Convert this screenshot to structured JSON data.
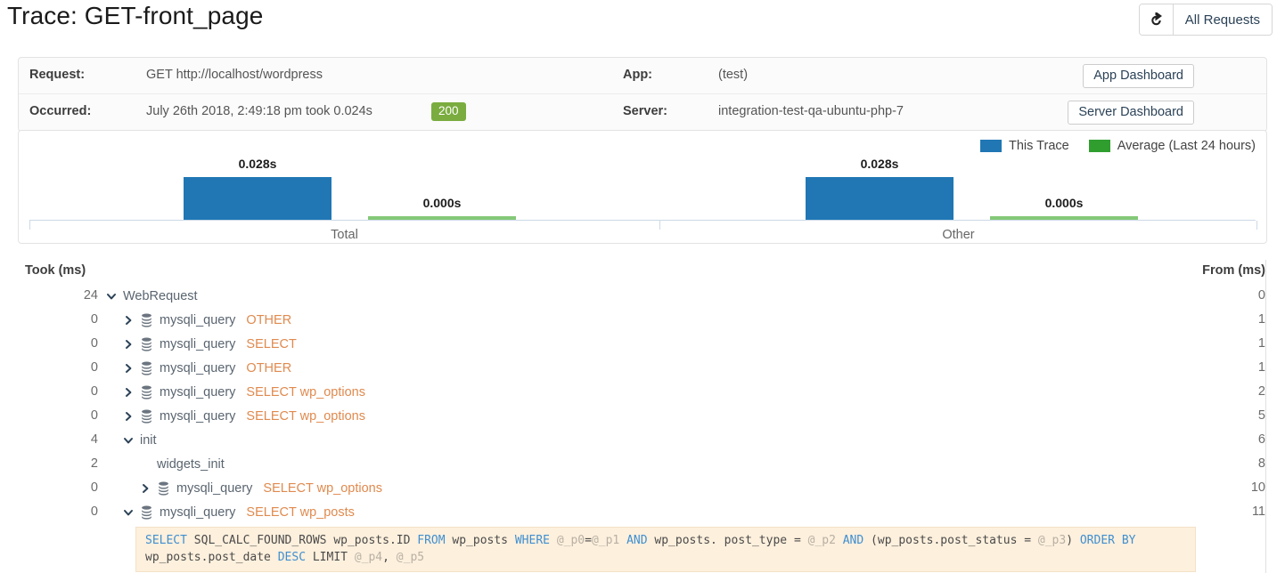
{
  "header": {
    "title": "Trace: GET-front_page",
    "refresh_icon": "share-refresh-icon",
    "all_requests_label": "All Requests"
  },
  "info": {
    "request_label": "Request:",
    "request_value": "GET http://localhost/wordpress",
    "occurred_label": "Occurred:",
    "occurred_value": "July 26th 2018, 2:49:18 pm took 0.024s",
    "status_code": "200",
    "status_color": "#7aac3f",
    "app_label": "App:",
    "app_value": "(test)",
    "server_label": "Server:",
    "server_value": "integration-test-qa-ubuntu-php-7",
    "app_dashboard_label": "App Dashboard",
    "server_dashboard_label": "Server Dashboard"
  },
  "chart_data": {
    "type": "bar",
    "title": "",
    "categories": [
      "Total",
      "Other"
    ],
    "series": [
      {
        "name": "This Trace",
        "color": "#2077b4",
        "values": [
          0.028,
          0.028
        ],
        "labels": [
          "0.028s",
          "0.028s"
        ]
      },
      {
        "name": "Average (Last 24 hours)",
        "color": "#2f9e2f",
        "bar_color": "#84c878",
        "values": [
          0.0,
          0.0
        ],
        "labels": [
          "0.000s",
          "0.000s"
        ]
      }
    ],
    "xlabel": "",
    "ylabel": "",
    "ylim": [
      0,
      0.035
    ],
    "grid": false,
    "legend_position": "top-right"
  },
  "legend": {
    "items": [
      {
        "label": "This Trace",
        "color": "#2077b4"
      },
      {
        "label": "Average (Last 24 hours)",
        "color": "#2f9e2f"
      }
    ]
  },
  "table": {
    "took_header": "Took (ms)",
    "from_header": "From (ms)",
    "rows": [
      {
        "took": "24",
        "level": 0,
        "toggle": "expanded",
        "icon": "none",
        "name": "WebRequest",
        "op": "",
        "from": "0"
      },
      {
        "took": "0",
        "level": 1,
        "toggle": "collapsed",
        "icon": "database",
        "name": "mysqli_query",
        "op": "OTHER",
        "from": "1"
      },
      {
        "took": "0",
        "level": 1,
        "toggle": "collapsed",
        "icon": "database",
        "name": "mysqli_query",
        "op": "SELECT",
        "from": "1"
      },
      {
        "took": "0",
        "level": 1,
        "toggle": "collapsed",
        "icon": "database",
        "name": "mysqli_query",
        "op": "OTHER",
        "from": "1"
      },
      {
        "took": "0",
        "level": 1,
        "toggle": "collapsed",
        "icon": "database",
        "name": "mysqli_query",
        "op": "SELECT wp_options",
        "from": "2"
      },
      {
        "took": "0",
        "level": 1,
        "toggle": "collapsed",
        "icon": "database",
        "name": "mysqli_query",
        "op": "SELECT wp_options",
        "from": "5"
      },
      {
        "took": "4",
        "level": 1,
        "toggle": "expanded",
        "icon": "none",
        "name": "init",
        "op": "",
        "from": "6"
      },
      {
        "took": "2",
        "level": 2,
        "toggle": "none",
        "icon": "none",
        "name": "widgets_init",
        "op": "",
        "from": "8"
      },
      {
        "took": "0",
        "level": 2,
        "toggle": "collapsed",
        "icon": "database",
        "name": "mysqli_query",
        "op": "SELECT wp_options",
        "from": "10"
      },
      {
        "took": "0",
        "level": 1,
        "toggle": "expanded",
        "icon": "database",
        "name": "mysqli_query",
        "op": "SELECT wp_posts",
        "from": "11"
      }
    ]
  },
  "sql": {
    "tokens": [
      {
        "t": "SELECT",
        "k": "kw"
      },
      {
        "t": " SQL_CALC_FOUND_ROWS wp_posts.ID ",
        "k": ""
      },
      {
        "t": "FROM",
        "k": "kw"
      },
      {
        "t": " wp_posts ",
        "k": ""
      },
      {
        "t": "WHERE",
        "k": "kw"
      },
      {
        "t": " ",
        "k": ""
      },
      {
        "t": "@_p0",
        "k": "param"
      },
      {
        "t": "=",
        "k": ""
      },
      {
        "t": "@_p1",
        "k": "param"
      },
      {
        "t": " ",
        "k": ""
      },
      {
        "t": "AND",
        "k": "kw"
      },
      {
        "t": " wp_posts. post_type = ",
        "k": ""
      },
      {
        "t": "@_p2",
        "k": "param"
      },
      {
        "t": " ",
        "k": ""
      },
      {
        "t": "AND",
        "k": "kw"
      },
      {
        "t": " (wp_posts.post_status = ",
        "k": ""
      },
      {
        "t": "@_p3",
        "k": "param"
      },
      {
        "t": ") ",
        "k": ""
      },
      {
        "t": "ORDER BY",
        "k": "kw"
      },
      {
        "t": " wp_posts.post_date ",
        "k": ""
      },
      {
        "t": "DESC",
        "k": "kw"
      },
      {
        "t": " LIMIT ",
        "k": ""
      },
      {
        "t": "@_p4",
        "k": "param"
      },
      {
        "t": ", ",
        "k": ""
      },
      {
        "t": "@_p5",
        "k": "param"
      }
    ]
  }
}
